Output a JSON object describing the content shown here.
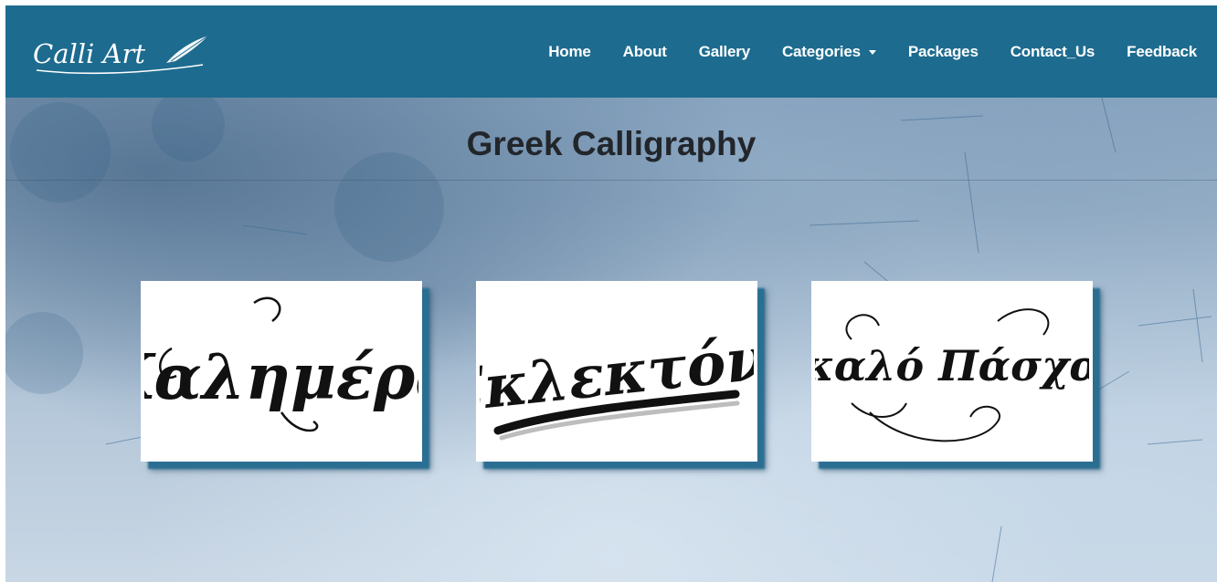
{
  "brand": {
    "logo_text": "Calli Art",
    "logo_icon": "quill-pen-icon"
  },
  "nav": {
    "items": [
      {
        "label": "Home"
      },
      {
        "label": "About"
      },
      {
        "label": "Gallery"
      },
      {
        "label": "Categories",
        "has_dropdown": true
      },
      {
        "label": "Packages"
      },
      {
        "label": "Contact_Us"
      },
      {
        "label": "Feedback"
      }
    ]
  },
  "page": {
    "title": "Greek Calligraphy"
  },
  "gallery": {
    "items": [
      {
        "text": "Καλημέρα"
      },
      {
        "text": "Εκλεκτόν!"
      },
      {
        "text": "καλό Πάσχα"
      }
    ]
  },
  "colors": {
    "navbar": "#1d6b8f",
    "nav_text": "#ffffff",
    "title_text": "#22262b",
    "card_shadow": "#2a6e92"
  }
}
